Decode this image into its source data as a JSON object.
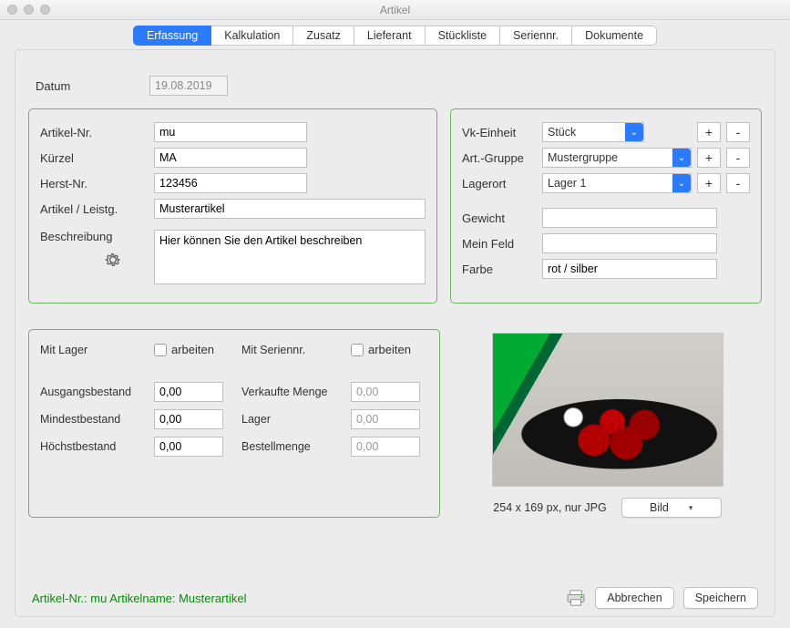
{
  "window": {
    "title": "Artikel"
  },
  "tabs": [
    "Erfassung",
    "Kalkulation",
    "Zusatz",
    "Lieferant",
    "Stückliste",
    "Seriennr.",
    "Dokumente"
  ],
  "active_tab": 0,
  "datum": {
    "label": "Datum",
    "value": "19.08.2019"
  },
  "left": {
    "artikelnr": {
      "label": "Artikel-Nr.",
      "value": "mu"
    },
    "kuerzel": {
      "label": "Kürzel",
      "value": "MA"
    },
    "herstnr": {
      "label": "Herst-Nr.",
      "value": "123456"
    },
    "artikel": {
      "label": "Artikel / Leistg.",
      "value": "Musterartikel"
    },
    "beschreibung": {
      "label": "Beschreibung",
      "value": "Hier können Sie den Artikel beschreiben"
    }
  },
  "right": {
    "vkeinheit": {
      "label": "Vk-Einheit",
      "value": "Stück"
    },
    "artgruppe": {
      "label": "Art.-Gruppe",
      "value": "Mustergruppe"
    },
    "lagerort": {
      "label": "Lagerort",
      "value": "Lager 1"
    },
    "gewicht": {
      "label": "Gewicht",
      "value": ""
    },
    "meinfeld": {
      "label": "Mein Feld",
      "value": ""
    },
    "farbe": {
      "label": "Farbe",
      "value": "rot / silber"
    },
    "plus": "+",
    "minus": "-"
  },
  "stock": {
    "mit_lager": {
      "label": "Mit Lager",
      "check": "arbeiten"
    },
    "mit_seriennr": {
      "label": "Mit Seriennr.",
      "check": "arbeiten"
    },
    "ausgang": {
      "label": "Ausgangsbestand",
      "value": "0,00"
    },
    "mindest": {
      "label": "Mindestbestand",
      "value": "0,00"
    },
    "hoechst": {
      "label": "Höchstbestand",
      "value": "0,00"
    },
    "verkauft": {
      "label": "Verkaufte Menge",
      "value": "0,00"
    },
    "lager": {
      "label": "Lager",
      "value": "0,00"
    },
    "bestell": {
      "label": "Bestellmenge",
      "value": "0,00"
    }
  },
  "image": {
    "caption": "254 x 169 px, nur JPG",
    "button": "Bild"
  },
  "footer": {
    "status": "Artikel-Nr.: mu Artikelname: Musterartikel",
    "cancel": "Abbrechen",
    "save": "Speichern"
  }
}
